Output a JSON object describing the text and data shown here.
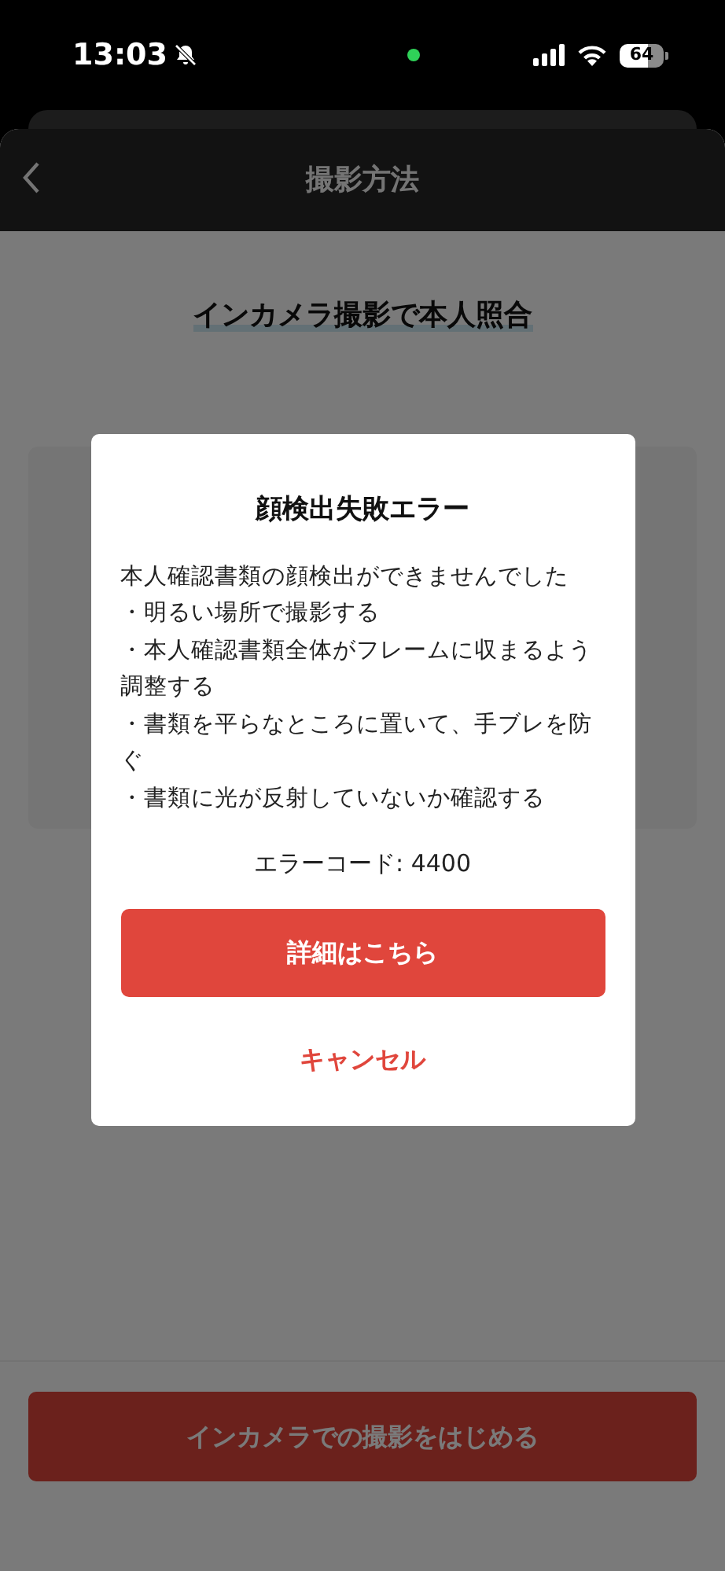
{
  "status_bar": {
    "time": "13:03",
    "battery": "64"
  },
  "header": {
    "title": "撮影方法"
  },
  "page": {
    "heading": "インカメラ撮影で本人照合"
  },
  "dialog": {
    "title": "顔検出失敗エラー",
    "message": "本人確認書類の顔検出ができませんでした",
    "bullets": [
      "・明るい場所で撮影する",
      "・本人確認書類全体がフレームに収まるよう調整する",
      "・書類を平らなところに置いて、手ブレを防ぐ",
      "・書類に光が反射していないか確認する"
    ],
    "error_code": "エラーコード: 4400",
    "primary_button": "詳細はこちら",
    "cancel_button": "キャンセル"
  },
  "footer": {
    "button": "インカメラでの撮影をはじめる"
  }
}
